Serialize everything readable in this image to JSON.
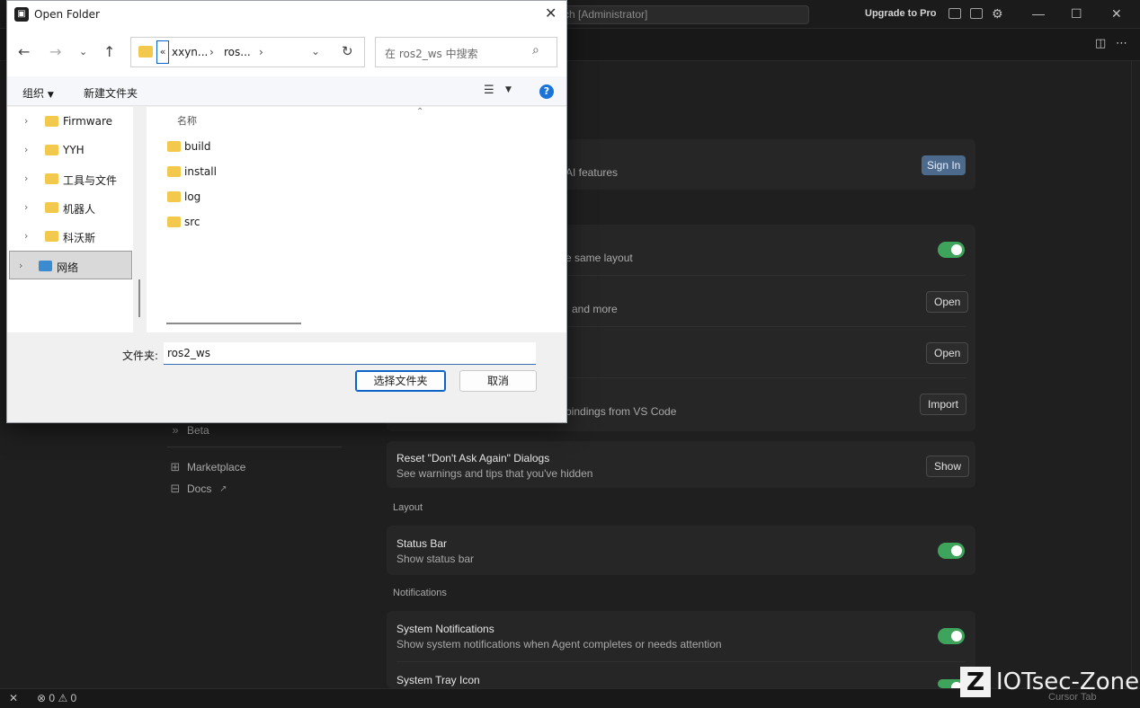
{
  "app": {
    "command_center": "ch [Administrator]",
    "upgrade_label": "Upgrade to Pro",
    "sidebar": {
      "beta": "Beta",
      "marketplace": "Marketplace",
      "docs": "Docs"
    },
    "account_desc": "AI features",
    "sign_in_label": "Sign In",
    "rows": {
      "layout_desc": "e same layout",
      "open1_desc": "and more",
      "open1_btn": "Open",
      "open2_btn": "Open",
      "import_desc": "bindings from VS Code",
      "import_btn": "Import",
      "reset_title": "Reset \"Don't Ask Again\" Dialogs",
      "reset_desc": "See warnings and tips that you've hidden",
      "reset_btn": "Show",
      "layout_section": "Layout",
      "status_title": "Status Bar",
      "status_desc": "Show status bar",
      "notifications_section": "Notifications",
      "sysnotif_title": "System Notifications",
      "sysnotif_desc": "Show system notifications when Agent completes or needs attention",
      "tray_title": "System Tray Icon"
    },
    "status_bar": {
      "errors": "0",
      "warnings": "0",
      "cursor_tab": "Cursor Tab"
    },
    "watermark": "IOTsec-Zone",
    "colors": {
      "toggle_on": "#3fa45b",
      "sign_in_bg": "#4b6a8c"
    }
  },
  "dialog": {
    "title": "Open Folder",
    "close_icon": "close-icon",
    "address": {
      "chevron": "«",
      "segment_1": "xxyn...",
      "segment_2": "ros..."
    },
    "search_placeholder": "在 ros2_ws 中搜索",
    "commands": {
      "organize": "组织",
      "new_folder": "新建文件夹"
    },
    "tree": [
      {
        "label": "Firmware"
      },
      {
        "label": "YYH"
      },
      {
        "label": "工具与文件"
      },
      {
        "label": "机器人"
      },
      {
        "label": "科沃斯"
      },
      {
        "label": "网络"
      }
    ],
    "column_name": "名称",
    "files": [
      {
        "label": "build"
      },
      {
        "label": "install"
      },
      {
        "label": "log"
      },
      {
        "label": "src"
      }
    ],
    "folder_label": "文件夹:",
    "folder_value": "ros2_ws",
    "select_button": "选择文件夹",
    "cancel_button": "取消"
  }
}
